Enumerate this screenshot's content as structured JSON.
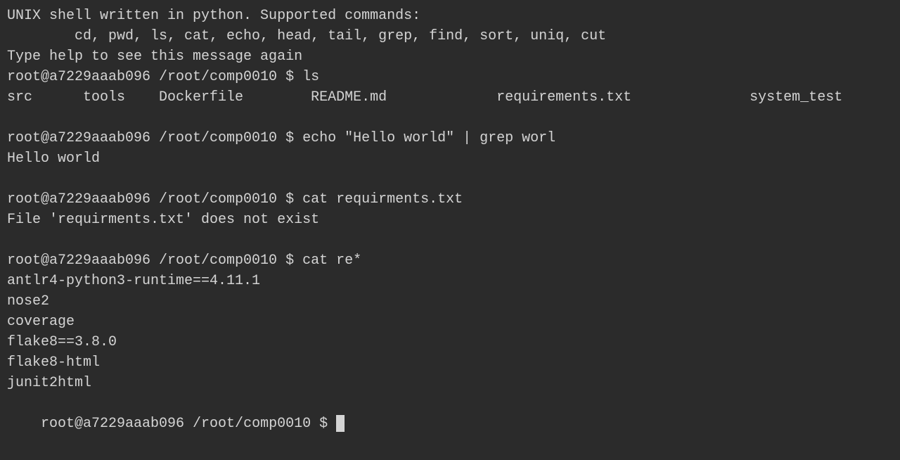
{
  "terminal": {
    "lines": [
      {
        "id": "line1",
        "text": "UNIX shell written in python. Supported commands:"
      },
      {
        "id": "line2",
        "text": "        cd, pwd, ls, cat, echo, head, tail, grep, find, sort, uniq, cut"
      },
      {
        "id": "line3",
        "text": "Type help to see this message again"
      },
      {
        "id": "line4",
        "text": "root@a7229aaab096 /root/comp0010 $ ls"
      },
      {
        "id": "line5",
        "text": "src      tools    Dockerfile        README.md             requirements.txt              system_test"
      },
      {
        "id": "line6",
        "text": ""
      },
      {
        "id": "line7",
        "text": "root@a7229aaab096 /root/comp0010 $ echo \"Hello world\" | grep worl"
      },
      {
        "id": "line8",
        "text": "Hello world"
      },
      {
        "id": "line9",
        "text": ""
      },
      {
        "id": "line10",
        "text": "root@a7229aaab096 /root/comp0010 $ cat requirments.txt"
      },
      {
        "id": "line11",
        "text": "File 'requirments.txt' does not exist"
      },
      {
        "id": "line12",
        "text": ""
      },
      {
        "id": "line13",
        "text": "root@a7229aaab096 /root/comp0010 $ cat re*"
      },
      {
        "id": "line14",
        "text": "antlr4-python3-runtime==4.11.1"
      },
      {
        "id": "line15",
        "text": "nose2"
      },
      {
        "id": "line16",
        "text": "coverage"
      },
      {
        "id": "line17",
        "text": "flake8==3.8.0"
      },
      {
        "id": "line18",
        "text": "flake8-html"
      },
      {
        "id": "line19",
        "text": "junit2html"
      },
      {
        "id": "line20",
        "text": "root@a7229aaab096 /root/comp0010 $ "
      }
    ],
    "prompt_label": "root@a7229aaab096 /root/comp0010 $ "
  }
}
